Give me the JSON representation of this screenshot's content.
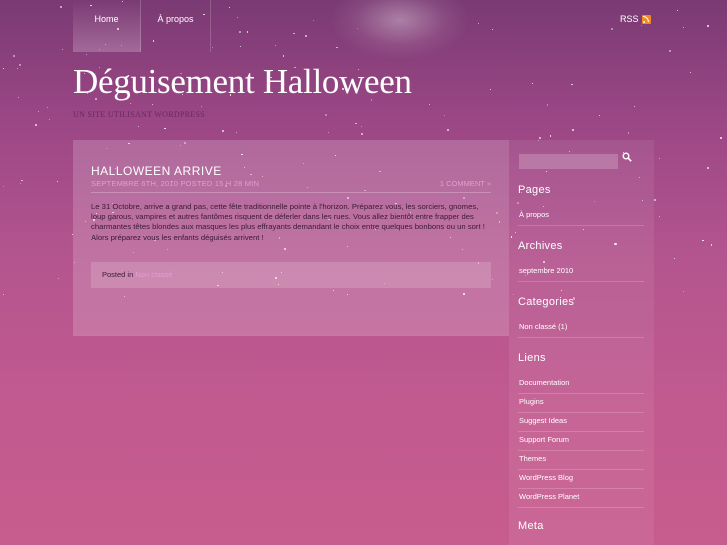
{
  "nav": {
    "items": [
      {
        "label": "Home"
      },
      {
        "label": "À propos"
      }
    ],
    "rss_label": "RSS"
  },
  "header": {
    "title": "Déguisement Halloween",
    "tagline": "UN SITE UTILISANT WORDPRESS"
  },
  "post": {
    "title": "HALLOWEEN ARRIVE",
    "meta": "SEPTEMBRE 6TH, 2010 POSTED 15 H 28 MIN",
    "comments": "1 COMMENT »",
    "body_paragraph": "Le 31 Octobre, arrive a grand pas, cette fête traditionnelle pointe à l'horizon. Préparez vous, les sorciers, gnomes, loup garous, vampires et autres fantômes risquent de déferler dans les rues. Vous allez bientôt entre frapper des charmantes têtes blondes aux masques les plus effrayants demandant le choix entre quelques bonbons ou un sort !",
    "body_line2": "Alors préparez vous les enfants déguisés arrivent !",
    "footer_prefix": "Posted in",
    "category": "Non classé"
  },
  "sidebar": {
    "pages_title": "Pages",
    "pages": [
      "À propos"
    ],
    "archives_title": "Archives",
    "archives": [
      "septembre 2010"
    ],
    "categories_title": "Categories",
    "categories": [
      "Non classé (1)"
    ],
    "links_title": "Liens",
    "links": [
      "Documentation",
      "Plugins",
      "Suggest Ideas",
      "Support Forum",
      "Themes",
      "WordPress Blog",
      "WordPress Planet"
    ],
    "meta_title": "Meta"
  },
  "colors": {
    "accent_link": "#e89ad0",
    "body_text": "#3a1a35",
    "rss": "#f08a24"
  }
}
